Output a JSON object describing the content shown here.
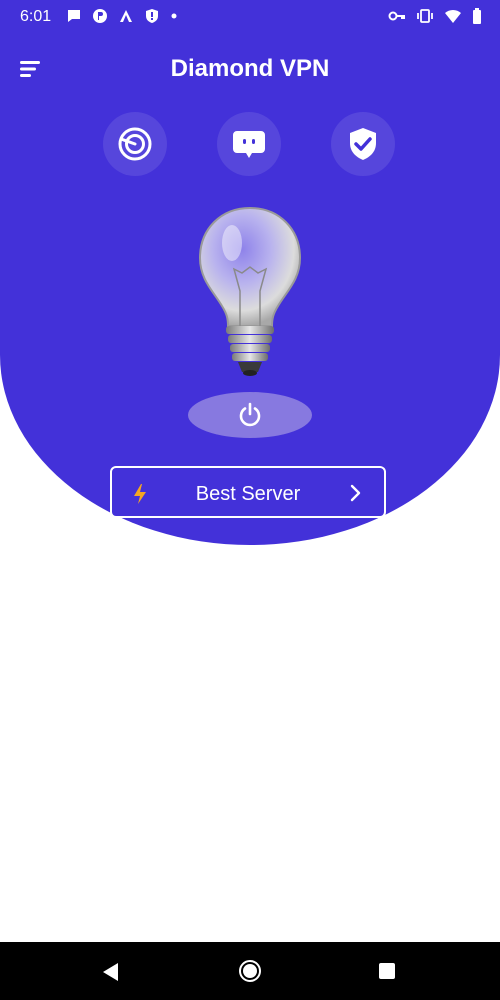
{
  "status_bar": {
    "time": "6:01",
    "left_icons": [
      "chat-bubble-icon",
      "p-app-icon",
      "a-app-icon",
      "shield-alert-icon",
      "dot-icon"
    ],
    "right_icons": [
      "vpn-key-icon",
      "vibrate-icon",
      "wifi-icon",
      "battery-icon"
    ]
  },
  "header": {
    "title": "Diamond VPN",
    "menu_icon": "menu-icon"
  },
  "features": [
    {
      "icon": "speedometer-icon"
    },
    {
      "icon": "chat-icon"
    },
    {
      "icon": "shield-check-icon"
    }
  ],
  "connection": {
    "status_image": "light-bulb-icon",
    "power_icon": "power-icon"
  },
  "server": {
    "label": "Best Server",
    "bolt_icon": "lightning-icon",
    "chevron_icon": "chevron-right-icon"
  },
  "nav": {
    "back": "back-icon",
    "home": "home-icon",
    "recents": "recents-icon"
  },
  "colors": {
    "primary": "#4331d9",
    "power_button": "#8779e0",
    "bolt": "#f5a623",
    "background": "#ffffff"
  }
}
